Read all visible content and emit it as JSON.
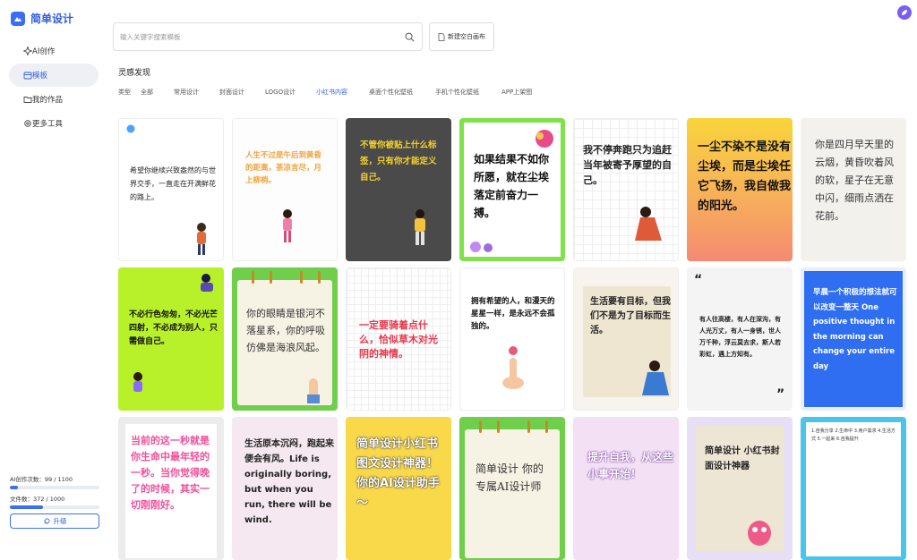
{
  "app": {
    "name": "简单设计",
    "brand_color": "#3b6ef5"
  },
  "sidebar": {
    "items": [
      {
        "label": "AI创作",
        "icon": "sparkle-icon"
      },
      {
        "label": "模板",
        "icon": "template-icon"
      },
      {
        "label": "我的作品",
        "icon": "folder-icon"
      },
      {
        "label": "更多工具",
        "icon": "gear-icon"
      }
    ],
    "usage": {
      "ai_label": "AI创作次数：99 / 1100",
      "ai_fraction": 0.09,
      "files_label": "文件数：372 / 1000",
      "files_fraction": 0.372
    },
    "upgrade_label": "升级"
  },
  "search": {
    "placeholder": "输入关键字搜索模板"
  },
  "new_canvas_label": "新建空白画布",
  "inspiration": {
    "title": "灵感发现",
    "type_label": "类型",
    "filters": [
      "全部",
      "常用设计",
      "封面设计",
      "LOGO设计",
      "小红书内容",
      "桌面个性化壁纸",
      "手机个性化壁纸",
      "APP上架图"
    ],
    "active_filter": "小红书内容"
  },
  "cards": [
    {
      "text": "希望你继续兴致盎然的与世界交手，一直走在开满鲜花的路上。"
    },
    {
      "text": "人生不过是午后到黄昏的距离，茶凉言尽，月上柳梢。"
    },
    {
      "text": "不管你被贴上什么标签，只有你才能定义自己。"
    },
    {
      "text": "如果结果不如你所愿，就在尘埃落定前奋力一搏。"
    },
    {
      "text": "我不停奔跑只为追赶当年被寄予厚望的自己。"
    },
    {
      "text": "一尘不染不是没有尘埃，而是尘埃任它飞扬，我自做我的阳光。"
    },
    {
      "text": "你是四月早天里的云烟，黄昏吹着风的软，星子在无意中闪，细雨点洒在花前。"
    },
    {
      "text": "不必行色匆匆，不必光芒四射，不必成为别人，只需做自己。"
    },
    {
      "text": "你的眼睛是银河不落星系，你的呼吸仿佛是海浪风起。"
    },
    {
      "text": "一定要骑着点什么，恰似草木对光阴的神情。"
    },
    {
      "text": "拥有希望的人，和漫天的星星一样，是永远不会孤独的。"
    },
    {
      "text": "生活要有目标，但我们不是为了目标而生活。"
    },
    {
      "text": "有人往高楼，有人在深沟，有人光万丈，有人一身锈，世人万千种，浮云莫去求，斯人若彩虹，遇上方知有。"
    },
    {
      "text": "早晨一个积极的想法就可以改变一整天 One positive thought in the morning can change your entire day"
    },
    {
      "text": "当前的这一秒就是你生命中最年轻的一秒。当你觉得晚了的时候，其实一切刚刚好。"
    },
    {
      "text": "生活原本沉闷，跑起来便会有风。Life is originally boring, but when you run, there will be wind."
    },
    {
      "text": "简单设计小红书图文设计神器！你的AI设计助手～"
    },
    {
      "text": "简单设计 你的专属AI设计师"
    },
    {
      "text": "提升自我，从这些小事开始！"
    },
    {
      "text": "简单设计 小红书封面设计神器"
    },
    {
      "text": "1.自我分享 2.生命中 3.用户需求 4.生活方式 5.一起来 6.自我提升"
    }
  ]
}
